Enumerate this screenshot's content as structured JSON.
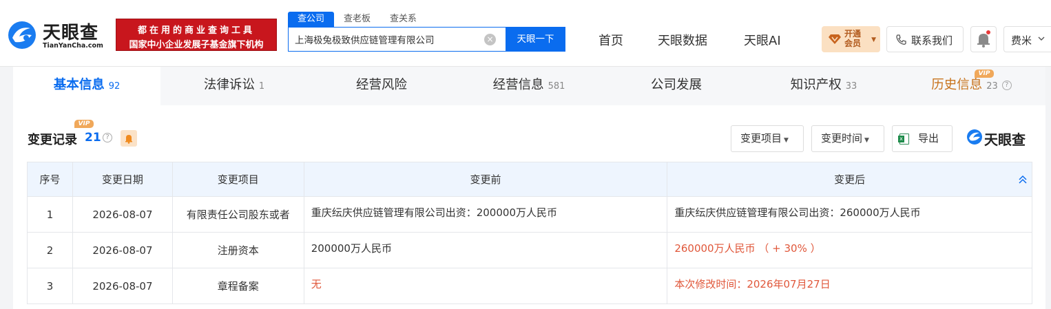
{
  "header": {
    "logo_cn": "天眼查",
    "logo_en": "TianYanCha.com",
    "banner_line1": "都在用的商业查询工具",
    "banner_line2": "国家中小企业发展子基金旗下机构",
    "search_tabs": [
      "查公司",
      "查老板",
      "查关系"
    ],
    "search_value": "上海极兔极致供应链管理有限公司",
    "search_button": "天眼一下",
    "nav": [
      "首页",
      "天眼数据",
      "天眼AI"
    ],
    "vip_line1": "开通",
    "vip_line2": "会员",
    "contact": "联系我们",
    "user": "费米"
  },
  "tabs": [
    {
      "label": "基本信息",
      "count": "92"
    },
    {
      "label": "法律诉讼",
      "count": "1"
    },
    {
      "label": "经营风险",
      "count": ""
    },
    {
      "label": "经营信息",
      "count": "581"
    },
    {
      "label": "公司发展",
      "count": ""
    },
    {
      "label": "知识产权",
      "count": "33"
    },
    {
      "label": "历史信息",
      "count": "23"
    }
  ],
  "vip_label": "VIP",
  "section": {
    "title": "变更记录",
    "count": "21",
    "filter_item": "变更项目",
    "filter_time": "变更时间",
    "export": "导出",
    "brand": "天眼查"
  },
  "table": {
    "headers": [
      "序号",
      "变更日期",
      "变更项目",
      "变更前",
      "变更后"
    ],
    "rows": [
      [
        "1",
        "2026-08-07",
        "有限责任公司股东或者",
        "重庆纭庆供应链管理有限公司出资：200000万人民币",
        "重庆纭庆供应链管理有限公司出资：260000万人民币"
      ],
      [
        "2",
        "2026-08-07",
        "注册资本",
        "200000万人民币",
        "260000万人民币 （ + 30% ）"
      ],
      [
        "3",
        "2026-08-07",
        "章程备案",
        "无",
        "本次修改时间：2026年07月27日"
      ]
    ]
  },
  "colors": {
    "accent": "#0a6cef",
    "highlight_red": "#e0573a",
    "vip_orange": "#f0a85a"
  }
}
